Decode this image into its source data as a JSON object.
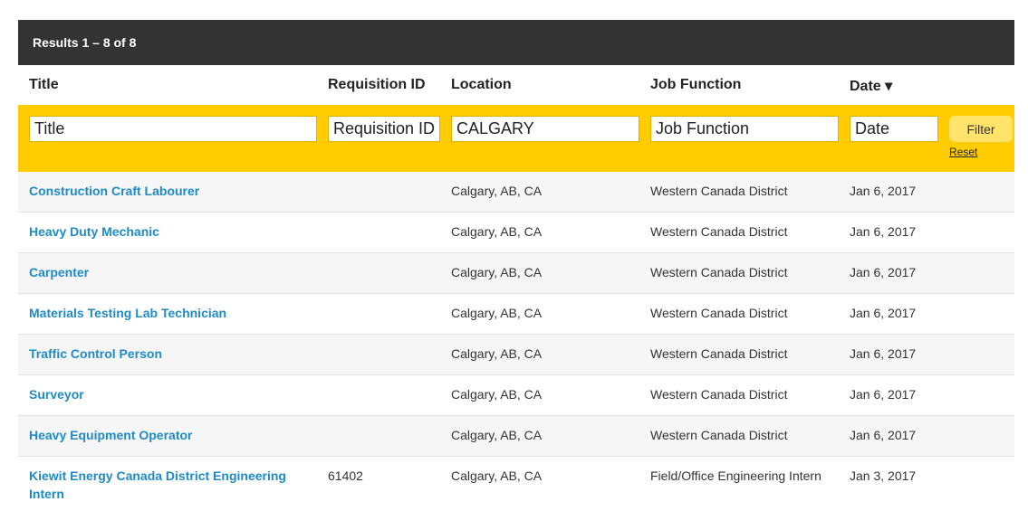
{
  "results_summary": "Results 1 – 8 of 8",
  "columns": {
    "title": "Title",
    "requisition_id": "Requisition ID",
    "location": "Location",
    "job_function": "Job Function",
    "date": "Date ▾"
  },
  "filters": {
    "title": "Title",
    "requisition_id": "Requisition ID",
    "location": "CALGARY",
    "job_function": "Job Function",
    "date": "Date",
    "filter_button": "Filter",
    "reset_link": "Reset"
  },
  "rows": [
    {
      "title": "Construction Craft Labourer",
      "requisition_id": "",
      "location": "Calgary, AB, CA",
      "job_function": "Western Canada District",
      "date": "Jan 6, 2017"
    },
    {
      "title": "Heavy Duty Mechanic",
      "requisition_id": "",
      "location": "Calgary, AB, CA",
      "job_function": "Western Canada District",
      "date": "Jan 6, 2017"
    },
    {
      "title": "Carpenter",
      "requisition_id": "",
      "location": "Calgary, AB, CA",
      "job_function": "Western Canada District",
      "date": "Jan 6, 2017"
    },
    {
      "title": "Materials Testing Lab Technician",
      "requisition_id": "",
      "location": "Calgary, AB, CA",
      "job_function": "Western Canada District",
      "date": "Jan 6, 2017"
    },
    {
      "title": "Traffic Control Person",
      "requisition_id": "",
      "location": "Calgary, AB, CA",
      "job_function": "Western Canada District",
      "date": "Jan 6, 2017"
    },
    {
      "title": "Surveyor",
      "requisition_id": "",
      "location": "Calgary, AB, CA",
      "job_function": "Western Canada District",
      "date": "Jan 6, 2017"
    },
    {
      "title": "Heavy Equipment Operator",
      "requisition_id": "",
      "location": "Calgary, AB, CA",
      "job_function": "Western Canada District",
      "date": "Jan 6, 2017"
    },
    {
      "title": "Kiewit Energy Canada District Engineering Intern",
      "requisition_id": "61402",
      "location": "Calgary, AB, CA",
      "job_function": "Field/Office Engineering Intern",
      "date": "Jan 3, 2017"
    }
  ],
  "colors": {
    "header_bar": "#333333",
    "filter_band": "#ffcc00",
    "filter_button": "#ffe36b",
    "link": "#1f8bc6"
  }
}
